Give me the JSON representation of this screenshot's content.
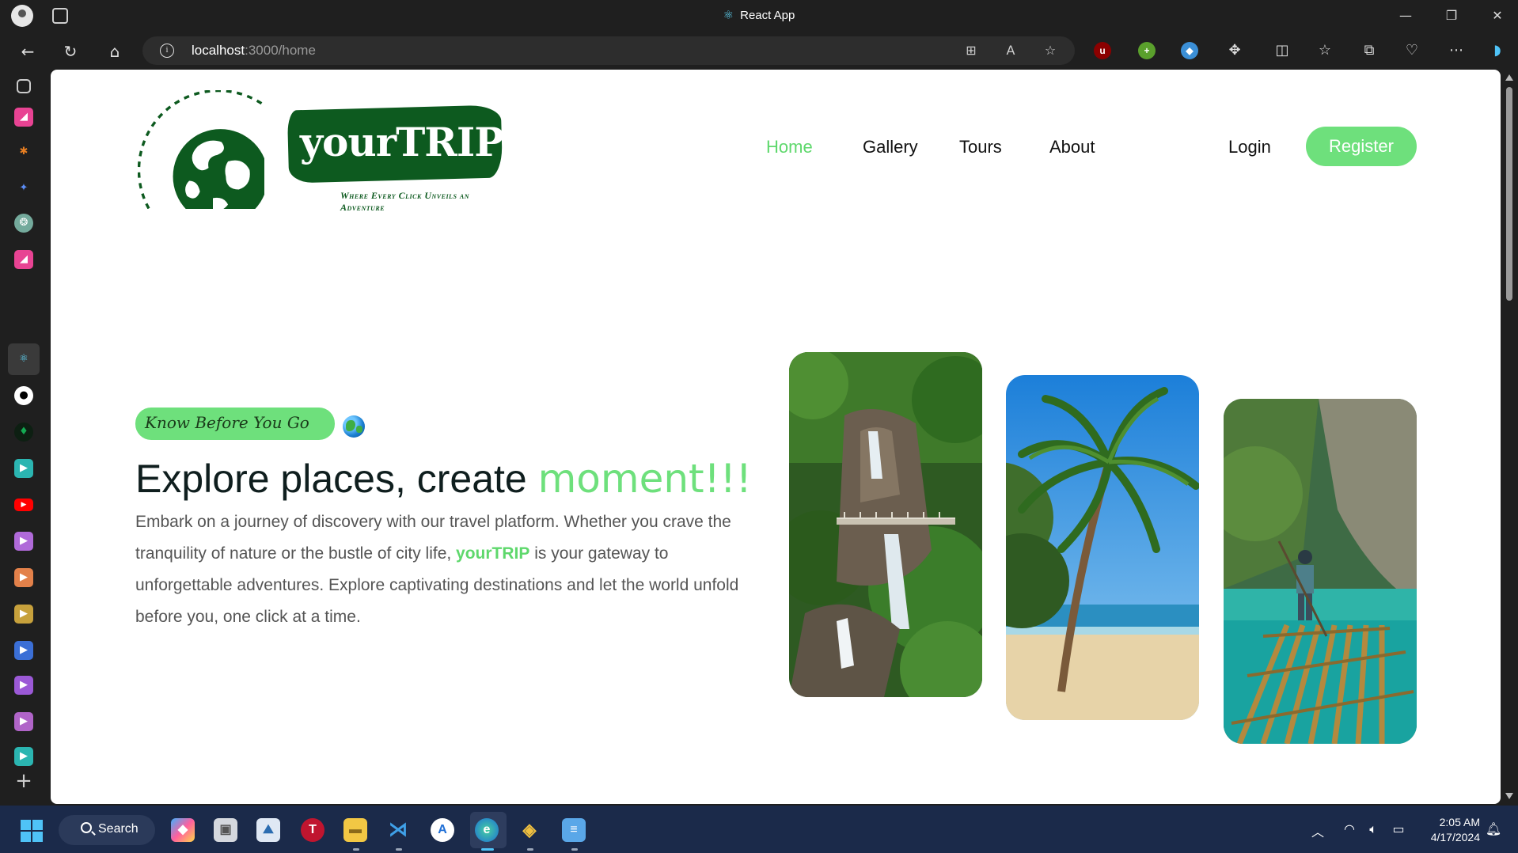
{
  "browser": {
    "window_title": "React App",
    "url_host": "localhost",
    "url_path": ":3000/home",
    "window_controls": {
      "minimize": "—",
      "restore": "❐",
      "close": "✕"
    }
  },
  "header": {
    "logo_name": "yourTRIP",
    "logo_tagline": "Where Every Click Unveils an Adventure",
    "nav": [
      {
        "label": "Home",
        "active": true
      },
      {
        "label": "Gallery",
        "active": false
      },
      {
        "label": "Tours",
        "active": false
      },
      {
        "label": "About",
        "active": false
      }
    ],
    "login_label": "Login",
    "register_label": "Register"
  },
  "hero": {
    "badge_text": "Know Before You Go",
    "headline_prefix": "Explore places, create ",
    "headline_accent": "moment!!!",
    "paragraph_part1": "Embark on a journey of discovery with our travel platform. Whether you crave the tranquility of nature or the bustle of city life, ",
    "paragraph_brand": "yourTRIP",
    "paragraph_part2": " is your gateway to unforgettable adventures. Explore captivating destinations and let the world unfold before you, one click at a time.",
    "images": [
      "waterfall-photo",
      "beach-palm-photo",
      "bamboo-raft-photo"
    ]
  },
  "taskbar": {
    "search_label": "Search",
    "time": "2:05 AM",
    "date": "4/17/2024"
  },
  "colors": {
    "accent_green": "#6ee07c",
    "logo_green": "#0d5a1f",
    "browser_chrome": "#1f1f1f",
    "taskbar": "#1b2a4a"
  }
}
